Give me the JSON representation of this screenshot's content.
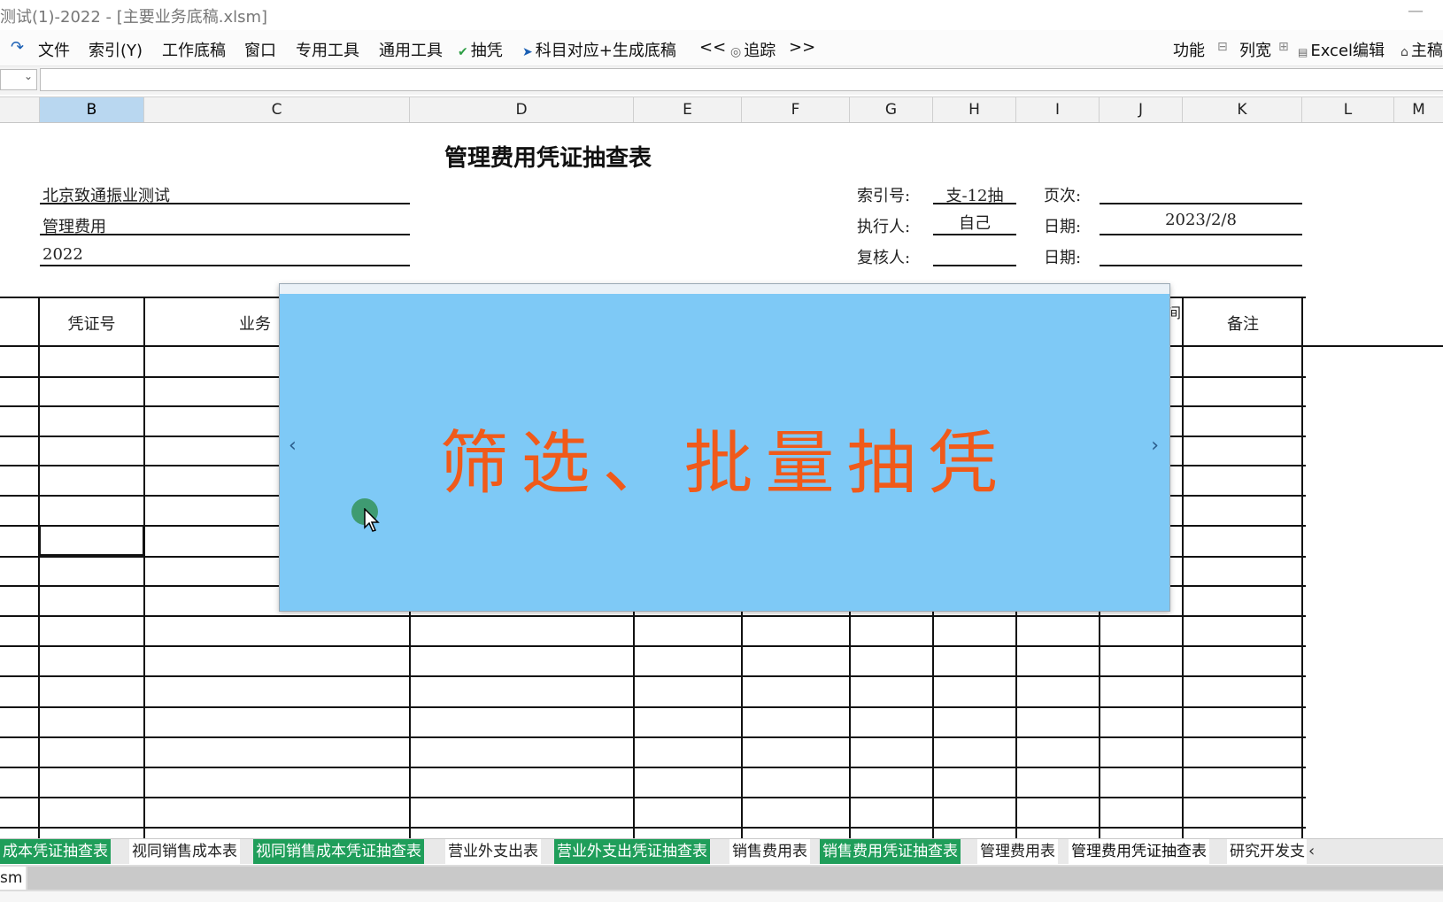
{
  "window": {
    "title": "测试(1)-2022 - [主要业务底稿.xlsm]",
    "minimize_icon": "minimize-icon"
  },
  "menu": {
    "redo_icon": "redo-icon",
    "items": [
      "文件",
      "索引(Y)",
      "工作底稿",
      "窗口",
      "专用工具",
      "通用工具"
    ],
    "choufeng": "抽凭",
    "kemu": "科目对应+生成底稿",
    "prev": "<<",
    "trace": "追踪",
    "next": ">>",
    "func": "功能",
    "colwidth": "列宽",
    "excel_edit": "Excel编辑",
    "home": "主稿"
  },
  "columns": [
    "B",
    "C",
    "D",
    "E",
    "F",
    "G",
    "H",
    "I",
    "J",
    "K",
    "L",
    "M"
  ],
  "selected_column": "B",
  "sheet": {
    "title": "管理费用凭证抽查表",
    "company": "北京致通振业测试",
    "account": "管理费用",
    "year": "2022",
    "index_label": "索引号:",
    "index_value": "支-12抽",
    "page_label": "页次:",
    "page_value": "",
    "executor_label": "执行人:",
    "executor_value": "自己",
    "date_label": "日期:",
    "date_value": "2023/2/8",
    "reviewer_label": "复核人:",
    "reviewer_value": "",
    "date2_label": "日期:",
    "date2_value": "",
    "headers": {
      "voucher_no": "凭证号",
      "business": "业务",
      "partial": "间",
      "remark": "备注"
    }
  },
  "overlay": {
    "text": "筛选、批量抽凭",
    "prev_arrow": "‹",
    "next_arrow": "›"
  },
  "tabs": [
    {
      "label": "成本凭证抽查表",
      "style": "green"
    },
    {
      "label": "视同销售成本表",
      "style": "plain"
    },
    {
      "label": "视同销售成本凭证抽查表",
      "style": "green"
    },
    {
      "label": "营业外支出表",
      "style": "plain"
    },
    {
      "label": "营业外支出凭证抽查表",
      "style": "green"
    },
    {
      "label": "销售费用表",
      "style": "plain"
    },
    {
      "label": "销售费用凭证抽查表",
      "style": "green"
    },
    {
      "label": "管理费用表",
      "style": "plain"
    },
    {
      "label": "管理费用凭证抽查表",
      "style": "active"
    },
    {
      "label": "研究开发支",
      "style": "plain"
    }
  ],
  "tab_scroll": "‹",
  "status": {
    "file_suffix": "sm"
  }
}
